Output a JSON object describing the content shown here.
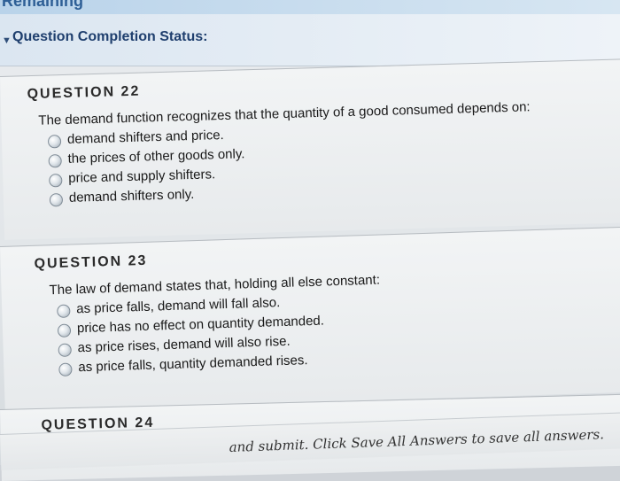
{
  "header": {
    "remaining_label": "Remaining",
    "status_label": "Question Completion Status:"
  },
  "questions": [
    {
      "title": "QUESTION 22",
      "prompt": "The demand function recognizes that the quantity of a good consumed depends on:",
      "options": [
        "demand shifters and price.",
        "the prices of other goods only.",
        "price and supply shifters.",
        "demand shifters only."
      ]
    },
    {
      "title": "QUESTION 23",
      "prompt": "The law of demand states that, holding all else constant:",
      "options": [
        "as price falls, demand will fall also.",
        "price has no effect on quantity demanded.",
        "as price rises, demand will also rise.",
        "as price falls, quantity demanded rises."
      ]
    },
    {
      "title": "QUESTION 24",
      "prompt": "",
      "options": []
    }
  ],
  "footer": {
    "save_instruction": "and submit. Click Save All Answers to save all answers."
  }
}
